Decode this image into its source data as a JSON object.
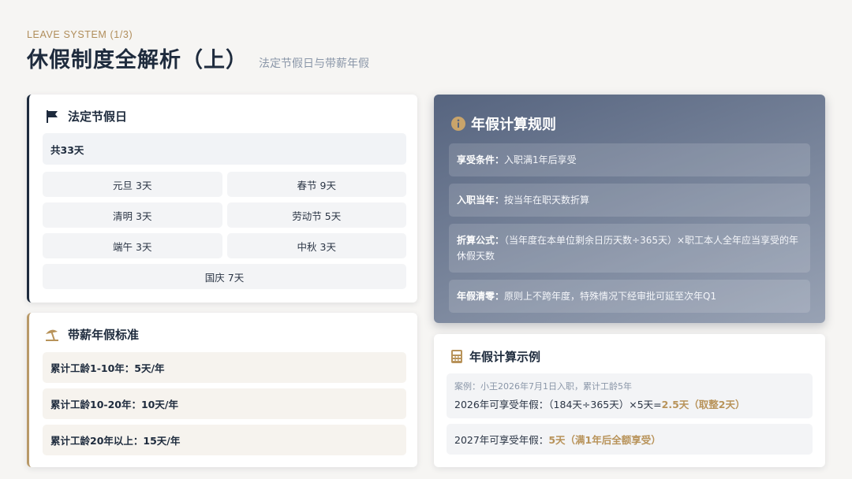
{
  "header": {
    "eyebrow": "LEAVE SYSTEM (1/3)",
    "title": "休假制度全解析（上）",
    "subtitle": "法定节假日与带薪年假"
  },
  "holidays": {
    "title": "法定节假日",
    "icon": "flag-icon",
    "total": "共33天",
    "items": [
      "元旦 3天",
      "春节 9天",
      "清明 3天",
      "劳动节 5天",
      "端午 3天",
      "中秋 3天",
      "国庆 7天"
    ]
  },
  "paid_leave": {
    "title": "带薪年假标准",
    "icon": "umbrella-beach-icon",
    "items": [
      "累计工龄1-10年：5天/年",
      "累计工龄10-20年：10天/年",
      "累计工龄20年以上：15天/年"
    ]
  },
  "rules": {
    "title": "年假计算规则",
    "icon": "info-circle-icon",
    "items": [
      {
        "key": "享受条件：",
        "value": "入职满1年后享受"
      },
      {
        "key": "入职当年：",
        "value": "按当年在职天数折算"
      },
      {
        "key": "折算公式：",
        "value": "（当年度在本单位剩余日历天数÷365天）×职工本人全年应当享受的年休假天数"
      },
      {
        "key": "年假清零：",
        "value": "原则上不跨年度，特殊情况下经审批可延至次年Q1"
      }
    ]
  },
  "example": {
    "title": "年假计算示例",
    "icon": "calculator-icon",
    "note": "案例：小王2026年7月1日入职，累计工龄5年",
    "line1_prefix": "2026年可享受年假：（184天÷365天）×5天=",
    "line1_result": "2.5天（取整2天）",
    "line2_prefix": "2027年可享受年假：",
    "line2_result": "5天（满1年后全额享受）"
  },
  "colors": {
    "navy": "#1e2b3d",
    "gold": "#b8935a",
    "rules_bg": "#56647f"
  }
}
